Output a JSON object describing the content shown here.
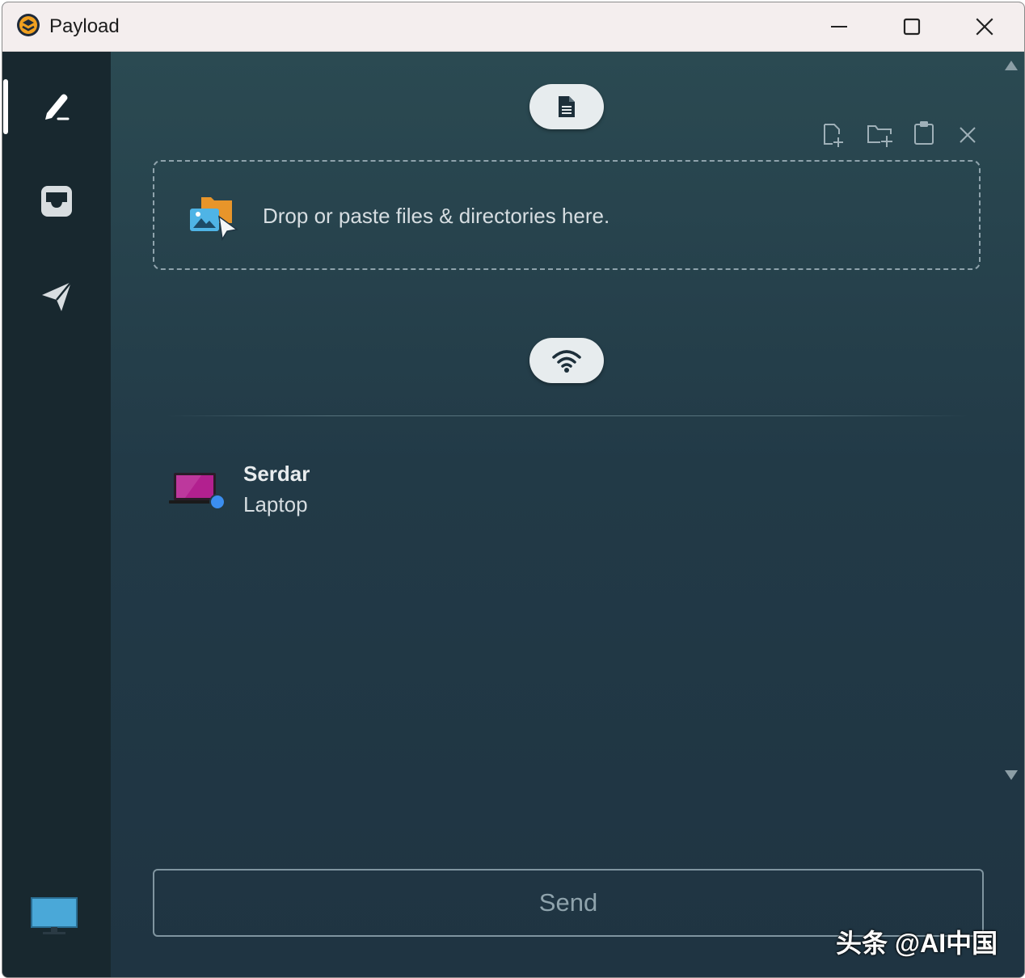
{
  "titlebar": {
    "title": "Payload",
    "app_icon": "payload-logo-icon",
    "minimize_icon": "minimize-icon",
    "maximize_icon": "maximize-icon",
    "close_icon": "close-icon"
  },
  "sidebar": {
    "items": [
      {
        "icon": "pencil-icon",
        "selected": true
      },
      {
        "icon": "inbox-icon",
        "selected": false
      },
      {
        "icon": "paper-plane-icon",
        "selected": false
      }
    ],
    "footer_icon": "monitor-icon"
  },
  "main": {
    "files_pill_icon": "document-icon",
    "toolbar": [
      {
        "icon": "add-file-icon"
      },
      {
        "icon": "add-folder-icon"
      },
      {
        "icon": "clipboard-icon"
      },
      {
        "icon": "clear-icon"
      }
    ],
    "dropzone": {
      "icon": "files-drop-icon",
      "text": "Drop or paste files & directories here."
    },
    "discovery_pill_icon": "wifi-icon",
    "devices": [
      {
        "name": "Serdar",
        "type": "Laptop",
        "icon": "laptop-icon",
        "status_color": "#3b8ef0"
      }
    ],
    "send_label": "Send"
  },
  "watermark": "头条 @AI中国",
  "colors": {
    "accent_laptop": "#b2208f",
    "status_dot": "#3b8ef0",
    "sidebar_bg": "#18282f",
    "main_bg": "#223a47"
  }
}
